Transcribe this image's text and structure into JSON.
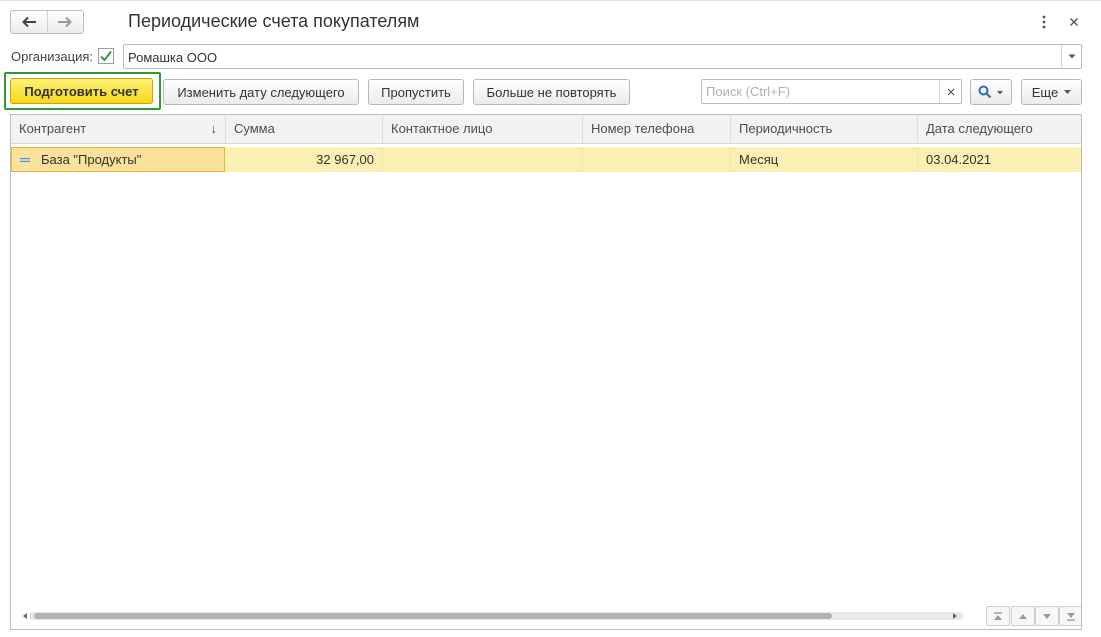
{
  "window": {
    "title": "Периодические счета покупателям",
    "back_icon": "arrow-left-icon",
    "forward_icon": "arrow-right-icon",
    "menu_icon": "kebab-icon",
    "close_icon": "close-icon"
  },
  "filter": {
    "org_label": "Организация:",
    "org_checked": true,
    "org_value": "Ромашка ООО"
  },
  "toolbar": {
    "prepare_label": "Подготовить счет",
    "change_date_label": "Изменить дату следующего",
    "skip_label": "Пропустить",
    "stop_label": "Больше не повторять",
    "search_placeholder": "Поиск (Ctrl+F)",
    "more_label": "Еще"
  },
  "table": {
    "columns": [
      "Контрагент",
      "Сумма",
      "Контактное лицо",
      "Номер телефона",
      "Периодичность",
      "Дата следующего"
    ],
    "sort_indicator": "↓",
    "rows": [
      {
        "counterparty": "База \"Продукты\"",
        "amount": "32 967,00",
        "contact": "",
        "phone": "",
        "period": "Месяц",
        "next_date": "03.04.2021"
      }
    ]
  },
  "colors": {
    "primary_button": "#f7d716",
    "highlight_border": "#2e9a3a",
    "selected_row": "#fbf0b4"
  }
}
